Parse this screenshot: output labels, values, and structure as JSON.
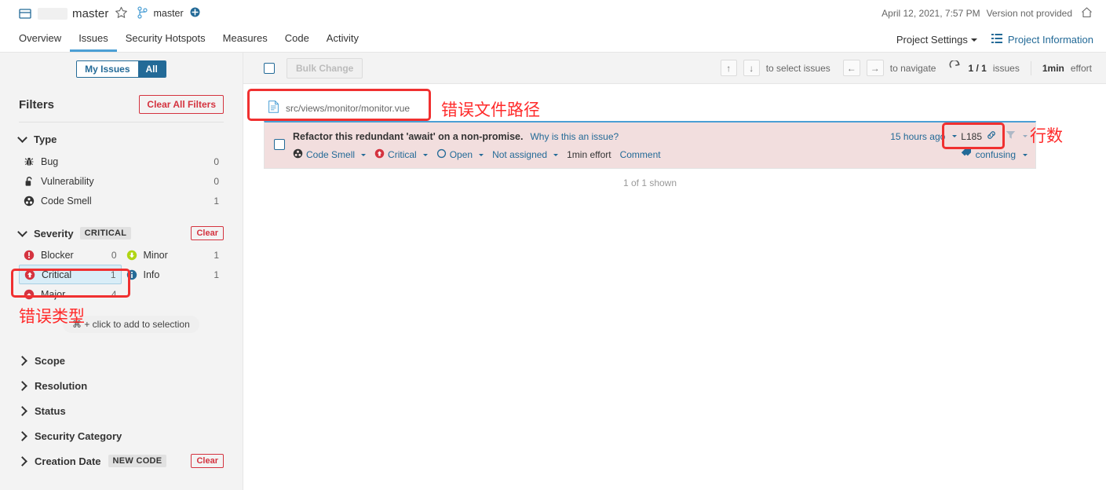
{
  "topbar": {
    "project_name": "master",
    "branch_name": "master",
    "analysis_date": "April 12, 2021, 7:57 PM",
    "version": "Version not provided",
    "icons": {
      "folder": "folder-icon",
      "star": "star-icon",
      "branch": "branch-icon",
      "plus": "plus-icon",
      "home": "home-icon"
    }
  },
  "nav": {
    "tabs": [
      {
        "label": "Overview",
        "active": false
      },
      {
        "label": "Issues",
        "active": true
      },
      {
        "label": "Security Hotspots",
        "active": false
      },
      {
        "label": "Measures",
        "active": false
      },
      {
        "label": "Code",
        "active": false
      },
      {
        "label": "Activity",
        "active": false
      }
    ],
    "project_settings": "Project Settings",
    "project_information": "Project Information"
  },
  "sidebar": {
    "toggle": {
      "my_issues": "My Issues",
      "all": "All",
      "selected": "All"
    },
    "filters_title": "Filters",
    "clear_all_label": "Clear All Filters",
    "type_facet": {
      "title": "Type",
      "rows": [
        {
          "label": "Bug",
          "count": "0",
          "icon": "bug-icon"
        },
        {
          "label": "Vulnerability",
          "count": "0",
          "icon": "vulnerability-icon"
        },
        {
          "label": "Code Smell",
          "count": "1",
          "icon": "code-smell-icon"
        }
      ]
    },
    "severity_facet": {
      "title": "Severity",
      "badge": "CRITICAL",
      "clear_label": "Clear",
      "left": [
        {
          "label": "Blocker",
          "count": "0",
          "icon": "blocker-icon",
          "selected": false
        },
        {
          "label": "Critical",
          "count": "1",
          "icon": "critical-icon",
          "selected": true
        },
        {
          "label": "Major",
          "count": "4",
          "icon": "major-icon",
          "selected": false
        }
      ],
      "right": [
        {
          "label": "Minor",
          "count": "1",
          "icon": "minor-icon",
          "selected": false
        },
        {
          "label": "Info",
          "count": "1",
          "icon": "info-icon",
          "selected": false
        }
      ]
    },
    "tooltip": "⌘ + click to add to selection",
    "collapsed_facets": [
      {
        "label": "Scope",
        "badge": "",
        "clear": ""
      },
      {
        "label": "Resolution",
        "badge": "",
        "clear": ""
      },
      {
        "label": "Status",
        "badge": "",
        "clear": ""
      },
      {
        "label": "Security Category",
        "badge": "",
        "clear": ""
      },
      {
        "label": "Creation Date",
        "badge": "NEW CODE",
        "clear": "Clear"
      }
    ]
  },
  "toolbar": {
    "bulk_change": "Bulk Change",
    "select_hint": "to select issues",
    "navigate_hint": "to navigate",
    "arrow_up": "↑",
    "arrow_down": "↓",
    "arrow_left": "←",
    "arrow_right": "→",
    "issues_count": "1 / 1",
    "issues_word": "issues",
    "effort_value": "1min",
    "effort_word": "effort"
  },
  "main": {
    "file_path": "src/views/monitor/monitor.vue",
    "issue": {
      "title": "Refactor this redundant 'await' on a non-promise.",
      "why_link": "Why is this an issue?",
      "type": "Code Smell",
      "severity": "Critical",
      "status": "Open",
      "assignee": "Not assigned",
      "effort": "1min effort",
      "comment": "Comment",
      "updated": "15 hours ago",
      "line": "L185",
      "tag": "confusing"
    },
    "shown_text": "1 of 1 shown"
  },
  "annotations": [
    {
      "text": "错误文件路径"
    },
    {
      "text": "行数"
    },
    {
      "text": "错误类型"
    }
  ],
  "colors": {
    "accent_blue": "#236a97",
    "link_blue": "#4b9fd5",
    "red": "#d4333f",
    "annotation_red": "#ff2a2a",
    "issue_bg": "#f2dede",
    "selected_bg": "#d9edf7",
    "sidebar_bg": "#f3f3f3"
  }
}
